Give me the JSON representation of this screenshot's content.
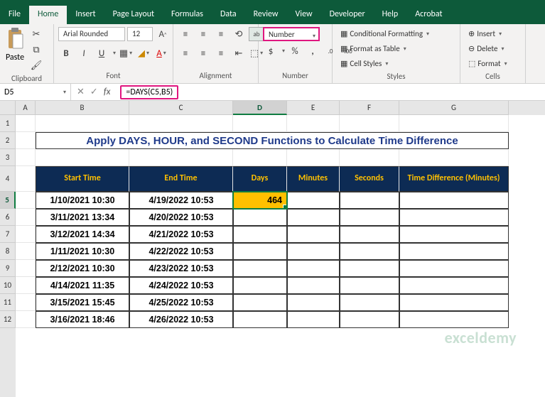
{
  "menu": {
    "tabs": [
      "File",
      "Home",
      "Insert",
      "Page Layout",
      "Formulas",
      "Data",
      "Review",
      "View",
      "Developer",
      "Help",
      "Acrobat"
    ],
    "active": 1
  },
  "ribbon": {
    "clipboard": {
      "label": "Clipboard",
      "paste": "Paste"
    },
    "font": {
      "label": "Font",
      "name": "Arial Rounded",
      "size": "12",
      "bold": "B",
      "italic": "I",
      "underline": "U",
      "sup": "A",
      "sub": "A"
    },
    "alignment": {
      "label": "Alignment"
    },
    "number": {
      "label": "Number",
      "format": "Number",
      "currency": "$",
      "percent": "%",
      "comma": ","
    },
    "styles": {
      "label": "Styles",
      "cond": "Conditional Formatting",
      "table": "Format as Table",
      "cell": "Cell Styles"
    },
    "cells": {
      "label": "Cells",
      "insert": "Insert",
      "delete": "Delete",
      "format": "Format"
    }
  },
  "formulabar": {
    "cellref": "D5",
    "formula": "=DAYS(C5,B5)"
  },
  "columns": [
    "A",
    "B",
    "C",
    "D",
    "E",
    "F",
    "G"
  ],
  "rows": [
    "1",
    "2",
    "3",
    "4",
    "5",
    "6",
    "7",
    "8",
    "9",
    "10",
    "11",
    "12"
  ],
  "title": "Apply DAYS, HOUR, and SECOND Functions to Calculate Time Difference",
  "headers": {
    "b": "Start Time",
    "c": "End Time",
    "d": "Days",
    "e": "Minutes",
    "f": "Seconds",
    "g": "Time Difference (Minutes)"
  },
  "data": [
    {
      "b": "1/10/2021 10:30",
      "c": "4/19/2022 10:53",
      "d": "464"
    },
    {
      "b": "3/11/2021 13:34",
      "c": "4/20/2022 10:53",
      "d": ""
    },
    {
      "b": "3/12/2021 14:34",
      "c": "4/21/2022 10:53",
      "d": ""
    },
    {
      "b": "1/11/2021 10:30",
      "c": "4/22/2022 10:53",
      "d": ""
    },
    {
      "b": "2/12/2021 10:30",
      "c": "4/23/2022 10:53",
      "d": ""
    },
    {
      "b": "4/14/2021 11:35",
      "c": "4/24/2022 10:53",
      "d": ""
    },
    {
      "b": "3/15/2021 15:45",
      "c": "4/25/2022 10:53",
      "d": ""
    },
    {
      "b": "3/16/2021 18:46",
      "c": "4/26/2022 10:53",
      "d": ""
    }
  ],
  "watermark": "exceldemy"
}
